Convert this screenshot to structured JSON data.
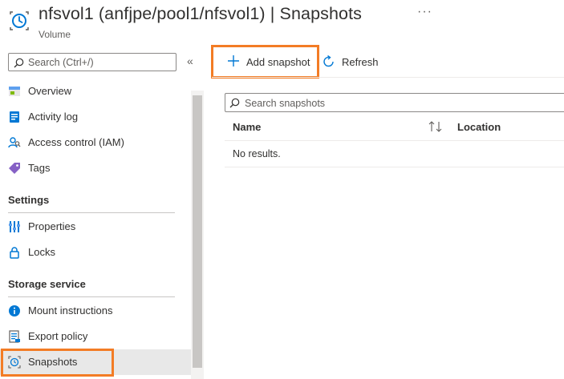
{
  "header": {
    "title": "nfsvol1 (anfjpe/pool1/nfsvol1)",
    "separator": " | ",
    "page": "Snapshots",
    "subtitle": "Volume",
    "more": "···",
    "icon": "clock-volume-icon"
  },
  "sidebar": {
    "search_placeholder": "Search (Ctrl+/)",
    "collapse": "«",
    "items": [
      {
        "label": "Overview",
        "icon": "overview-icon"
      },
      {
        "label": "Activity log",
        "icon": "activity-log-icon"
      },
      {
        "label": "Access control (IAM)",
        "icon": "iam-people-icon"
      },
      {
        "label": "Tags",
        "icon": "tag-icon"
      }
    ],
    "sections": [
      {
        "title": "Settings",
        "items": [
          {
            "label": "Properties",
            "icon": "properties-icon"
          },
          {
            "label": "Locks",
            "icon": "lock-icon"
          }
        ]
      },
      {
        "title": "Storage service",
        "items": [
          {
            "label": "Mount instructions",
            "icon": "info-icon"
          },
          {
            "label": "Export policy",
            "icon": "export-policy-icon"
          },
          {
            "label": "Snapshots",
            "icon": "snapshot-clock-icon",
            "selected": true
          }
        ]
      }
    ]
  },
  "toolbar": {
    "add_label": "Add snapshot",
    "refresh_label": "Refresh"
  },
  "main": {
    "filter_placeholder": "Search snapshots",
    "columns": [
      "Name",
      "Location"
    ],
    "empty_text": "No results."
  },
  "colors": {
    "highlight": "#f37c25",
    "accent": "#0078d4"
  }
}
